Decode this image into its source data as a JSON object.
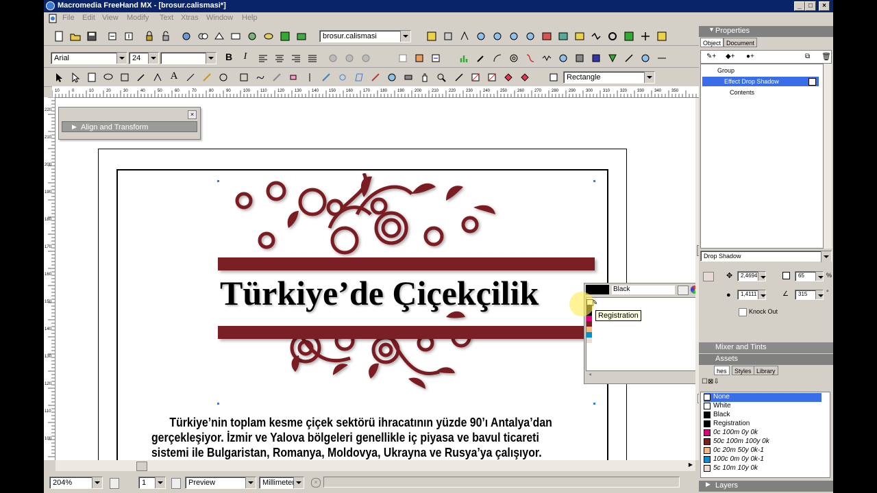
{
  "window": {
    "title": "Macromedia FreeHand MX - [brosur.calismasi*]"
  },
  "menu": [
    "File",
    "Edit",
    "View",
    "Modify",
    "Text",
    "Xtras",
    "Window",
    "Help"
  ],
  "toolbar": {
    "document_select": "brosur.calismasi",
    "font_family": "Arial",
    "font_size": "24",
    "font_style": "",
    "tool_shape": "Rectangle"
  },
  "ruler": {
    "h_labels": [
      "10",
      "0",
      "10",
      "20",
      "30",
      "40",
      "50",
      "60",
      "70",
      "80",
      "90",
      "100",
      "110",
      "120",
      "130",
      "140",
      "150",
      "160",
      "170",
      "180",
      "190",
      "200",
      "210",
      "220",
      "230",
      "240",
      "250",
      "260",
      "270",
      "280",
      "290",
      "300",
      "310",
      "320",
      "330",
      "340",
      "350"
    ],
    "v_labels": [
      "220",
      "210",
      "200",
      "190",
      "180",
      "170",
      "160",
      "150",
      "140",
      "130",
      "120",
      "110",
      "100"
    ]
  },
  "align_panel": {
    "title": "Align and Transform"
  },
  "document": {
    "heading": "Türkiye’de Çiçekçilik",
    "body_line1": "Türkiye’nin toplam kesme çiçek sektörü ihracatının yüzde 90’ı Antalya’dan",
    "body_line2": "gerçekleşiyor. İzmir ve Yalova bölgeleri genellikle iç piyasa ve bavul ticareti",
    "body_line3": "sistemi ile Bulgaristan, Romanya, Moldovya, Ukrayna ve Rusya’ya çalışıyor.",
    "accent_color": "#7a1f24"
  },
  "swatch_popup": {
    "current": "Black",
    "tooltip": "Registration"
  },
  "statusbar": {
    "zoom": "204%",
    "page": "1",
    "view_mode": "Preview",
    "units": "Millimeters"
  },
  "properties": {
    "title": "Properties",
    "tabs": [
      "Object",
      "Document"
    ],
    "tree": [
      "Group",
      "Effect Drop Shadow",
      "Contents"
    ],
    "effect": "Drop Shadow",
    "offset_x": "2,4694",
    "offset_y": "1,4111",
    "opacity": "65",
    "angle": "315",
    "knock_out": "Knock Out"
  },
  "mixer": {
    "title": "Mixer and Tints"
  },
  "assets": {
    "title": "Assets",
    "tabs": [
      "hes",
      "Styles",
      "Library"
    ],
    "swatches": [
      {
        "name": "None",
        "color": "#ffffff"
      },
      {
        "name": "White",
        "color": "#ffffff"
      },
      {
        "name": "Black",
        "color": "#000000"
      },
      {
        "name": "Registration",
        "color": "#000000"
      },
      {
        "name": "0c 100m 0y 0k",
        "color": "#e0007a"
      },
      {
        "name": "50c 100m 100y 0k",
        "color": "#7a1f24"
      },
      {
        "name": "0c 20m 50y 0k-1",
        "color": "#f7b97f"
      },
      {
        "name": "100c 0m 0y 0k-1",
        "color": "#0091d5"
      },
      {
        "name": "5c 10m 10y 0k",
        "color": "#ecdcd6"
      }
    ]
  },
  "layers": {
    "title": "Layers"
  }
}
